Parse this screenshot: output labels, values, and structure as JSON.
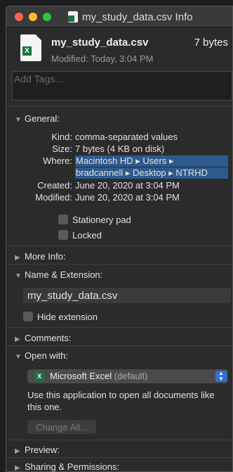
{
  "window": {
    "title": "my_study_data.csv Info"
  },
  "header": {
    "filename": "my_study_data.csv",
    "size": "7 bytes",
    "modified": "Modified: Today, 3:04 PM"
  },
  "tags": {
    "placeholder": "Add Tags..."
  },
  "general": {
    "title": "General:",
    "kind_label": "Kind:",
    "kind_value": "comma-separated values",
    "size_label": "Size:",
    "size_value": "7 bytes (4 KB on disk)",
    "where_label": "Where:",
    "where_line1": "Macintosh HD ▸ Users ▸",
    "where_line2": "bradcannell ▸ Desktop ▸ NTRHD",
    "created_label": "Created:",
    "created_value": "June 20, 2020 at 3:04 PM",
    "modified_label": "Modified:",
    "modified_value": "June 20, 2020 at 3:04 PM",
    "stationery_label": "Stationery pad",
    "locked_label": "Locked"
  },
  "more_info": {
    "title": "More Info:"
  },
  "name_ext": {
    "title": "Name & Extension:",
    "name_value": "my_study_data.csv",
    "hide_ext_label": "Hide extension"
  },
  "comments": {
    "title": "Comments:"
  },
  "open_with": {
    "title": "Open with:",
    "app_name": "Microsoft Excel",
    "app_default": "(default)",
    "help_text": "Use this application to open all documents like this one.",
    "change_all_label": "Change All..."
  },
  "preview": {
    "title": "Preview:"
  },
  "sharing": {
    "title": "Sharing & Permissions:"
  },
  "icons": {
    "file": "excel-file-icon",
    "app": "excel-app-icon"
  },
  "colors": {
    "highlight": "#2d5a8d",
    "accent": "#2f6fd8"
  }
}
